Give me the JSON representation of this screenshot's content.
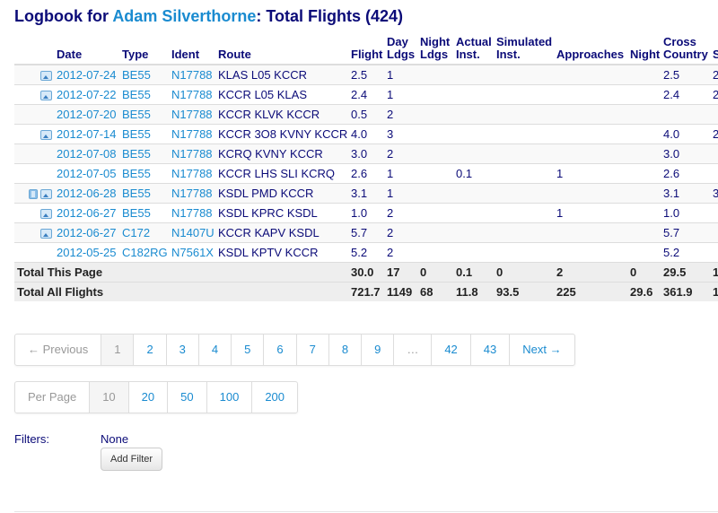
{
  "header": {
    "prefix": "Logbook for ",
    "pilot_name": "Adam Silverthorne",
    "suffix": ": Total Flights (424)"
  },
  "table": {
    "columns": [
      "",
      "Date",
      "Type",
      "Ident",
      "Route",
      "Flight",
      "Day Ldgs",
      "Night Ldgs",
      "Actual Inst.",
      "Simulated Inst.",
      "Approaches",
      "Night",
      "Cross Country",
      "S"
    ],
    "rows": [
      {
        "icons": [
          "photo-icon"
        ],
        "date": "2012-07-24",
        "type": "BE55",
        "ident": "N17788",
        "route": "KLAS L05 KCCR",
        "flight": "2.5",
        "day_ldgs": "1",
        "night_ldgs": "",
        "actual_inst": "",
        "sim_inst": "",
        "approaches": "",
        "night": "",
        "cross_country": "2.5",
        "clipped": "2"
      },
      {
        "icons": [
          "photo-icon"
        ],
        "date": "2012-07-22",
        "type": "BE55",
        "ident": "N17788",
        "route": "KCCR L05 KLAS",
        "flight": "2.4",
        "day_ldgs": "1",
        "night_ldgs": "",
        "actual_inst": "",
        "sim_inst": "",
        "approaches": "",
        "night": "",
        "cross_country": "2.4",
        "clipped": "2"
      },
      {
        "icons": [],
        "date": "2012-07-20",
        "type": "BE55",
        "ident": "N17788",
        "route": "KCCR KLVK KCCR",
        "flight": "0.5",
        "day_ldgs": "2",
        "night_ldgs": "",
        "actual_inst": "",
        "sim_inst": "",
        "approaches": "",
        "night": "",
        "cross_country": "",
        "clipped": ""
      },
      {
        "icons": [
          "photo-icon"
        ],
        "date": "2012-07-14",
        "type": "BE55",
        "ident": "N17788",
        "route": "KCCR 3O8 KVNY KCCR",
        "flight": "4.0",
        "day_ldgs": "3",
        "night_ldgs": "",
        "actual_inst": "",
        "sim_inst": "",
        "approaches": "",
        "night": "",
        "cross_country": "4.0",
        "clipped": "2"
      },
      {
        "icons": [],
        "date": "2012-07-08",
        "type": "BE55",
        "ident": "N17788",
        "route": "KCRQ KVNY KCCR",
        "flight": "3.0",
        "day_ldgs": "2",
        "night_ldgs": "",
        "actual_inst": "",
        "sim_inst": "",
        "approaches": "",
        "night": "",
        "cross_country": "3.0",
        "clipped": ""
      },
      {
        "icons": [],
        "date": "2012-07-05",
        "type": "BE55",
        "ident": "N17788",
        "route": "KCCR LHS SLI KCRQ",
        "flight": "2.6",
        "day_ldgs": "1",
        "night_ldgs": "",
        "actual_inst": "0.1",
        "sim_inst": "",
        "approaches": "1",
        "night": "",
        "cross_country": "2.6",
        "clipped": ""
      },
      {
        "icons": [
          "film-icon",
          "photo-icon"
        ],
        "date": "2012-06-28",
        "type": "BE55",
        "ident": "N17788",
        "route": "KSDL PMD KCCR",
        "flight": "3.1",
        "day_ldgs": "1",
        "night_ldgs": "",
        "actual_inst": "",
        "sim_inst": "",
        "approaches": "",
        "night": "",
        "cross_country": "3.1",
        "clipped": "3"
      },
      {
        "icons": [
          "photo-icon"
        ],
        "date": "2012-06-27",
        "type": "BE55",
        "ident": "N17788",
        "route": "KSDL KPRC KSDL",
        "flight": "1.0",
        "day_ldgs": "2",
        "night_ldgs": "",
        "actual_inst": "",
        "sim_inst": "",
        "approaches": "1",
        "night": "",
        "cross_country": "1.0",
        "clipped": ""
      },
      {
        "icons": [
          "photo-icon"
        ],
        "date": "2012-06-27",
        "type": "C172",
        "ident": "N1407U",
        "route": "KCCR KAPV KSDL",
        "flight": "5.7",
        "day_ldgs": "2",
        "night_ldgs": "",
        "actual_inst": "",
        "sim_inst": "",
        "approaches": "",
        "night": "",
        "cross_country": "5.7",
        "clipped": ""
      },
      {
        "icons": [],
        "date": "2012-05-25",
        "type": "C182RG",
        "ident": "N7561X",
        "route": "KSDL KPTV KCCR",
        "flight": "5.2",
        "day_ldgs": "2",
        "night_ldgs": "",
        "actual_inst": "",
        "sim_inst": "",
        "approaches": "",
        "night": "",
        "cross_country": "5.2",
        "clipped": ""
      }
    ],
    "totals": [
      {
        "label": "Total This Page",
        "flight": "30.0",
        "day_ldgs": "17",
        "night_ldgs": "0",
        "actual_inst": "0.1",
        "sim_inst": "0",
        "approaches": "2",
        "night": "0",
        "cross_country": "29.5",
        "clipped": "1"
      },
      {
        "label": "Total All Flights",
        "flight": "721.7",
        "day_ldgs": "1149",
        "night_ldgs": "68",
        "actual_inst": "11.8",
        "sim_inst": "93.5",
        "approaches": "225",
        "night": "29.6",
        "cross_country": "361.9",
        "clipped": "1"
      }
    ]
  },
  "pagination": {
    "previous": "← Previous",
    "pages": [
      "1",
      "2",
      "3",
      "4",
      "5",
      "6",
      "7",
      "8",
      "9",
      "…",
      "42",
      "43"
    ],
    "active_page": "1",
    "next": "Next →"
  },
  "per_page": {
    "label": "Per Page",
    "options": [
      "10",
      "20",
      "50",
      "100",
      "200"
    ],
    "selected": "10"
  },
  "filters": {
    "label": "Filters:",
    "value": "None",
    "add_button": "Add Filter"
  },
  "colors": {
    "heading": "#0b0b78",
    "link": "#1a8bd0",
    "stripe": "#f9f9f9",
    "total_bg": "#eeeeee"
  }
}
